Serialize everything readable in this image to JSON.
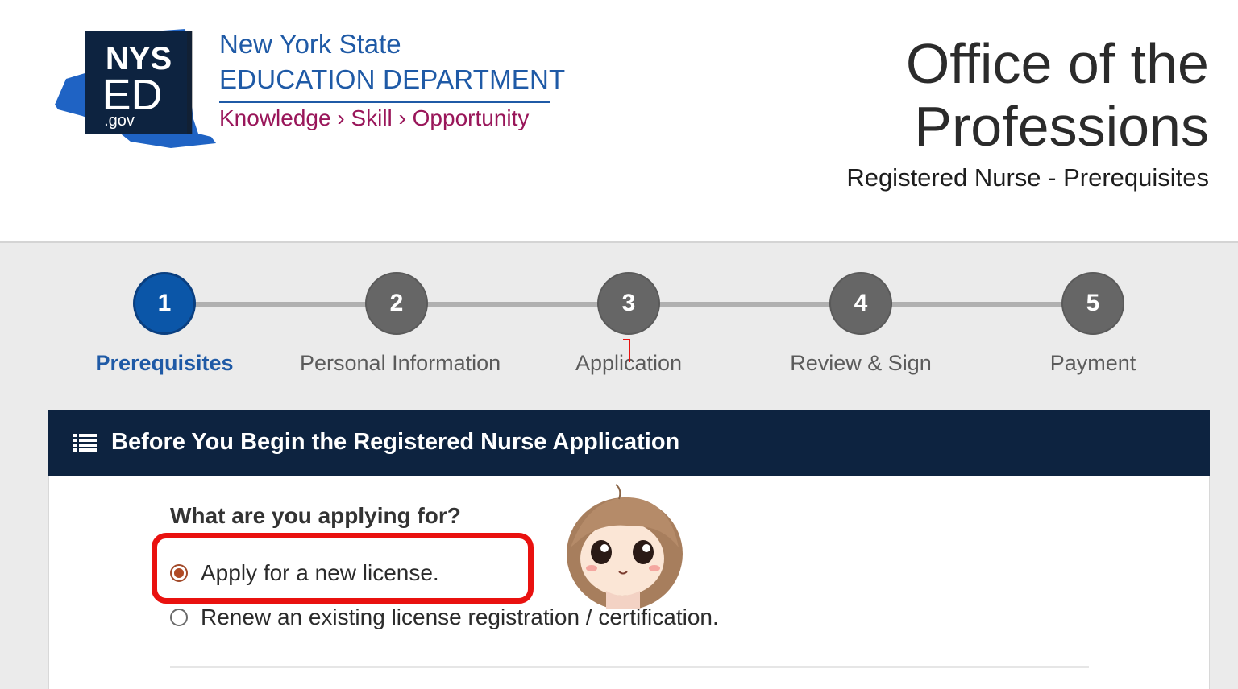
{
  "agency": {
    "name_line1": "New York State",
    "name_line2": "EDUCATION DEPARTMENT",
    "tagline": "Knowledge › Skill › Opportunity",
    "logo_text_top": "NYS",
    "logo_text_mid": "ED",
    "logo_text_bottom": ".gov"
  },
  "office": {
    "title_line1": "Office of the",
    "title_line2": "Professions",
    "subtitle": "Registered Nurse - Prerequisites"
  },
  "steps": [
    {
      "number": "1",
      "label": "Prerequisites",
      "active": true
    },
    {
      "number": "2",
      "label": "Personal Information",
      "active": false
    },
    {
      "number": "3",
      "label": "Application",
      "active": false
    },
    {
      "number": "4",
      "label": "Review & Sign",
      "active": false
    },
    {
      "number": "5",
      "label": "Payment",
      "active": false
    }
  ],
  "panel": {
    "icon": "list-icon",
    "title": "Before You Begin the Registered Nurse Application",
    "question": "What are you applying for?",
    "options": [
      {
        "label": "Apply for a new license.",
        "selected": true
      },
      {
        "label": "Renew an existing license registration / certification.",
        "selected": false
      }
    ]
  },
  "colors": {
    "brand_blue": "#1f5aa6",
    "tagline_magenta": "#99165a",
    "active_step": "#0b56a8",
    "inactive_step": "#666666",
    "panel_header": "#0d2340",
    "highlight": "#e9110f"
  }
}
